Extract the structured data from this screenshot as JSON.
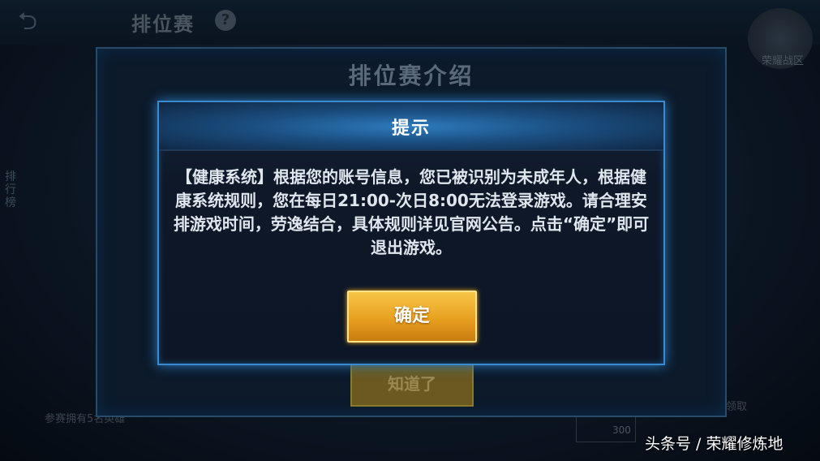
{
  "background": {
    "title": "排位赛",
    "help_icon": "?",
    "back_icon": "back-arrow-icon",
    "honor_label": "荣耀战区",
    "left_label": "排行榜",
    "bottom_text": "参赛拥有5名英雄",
    "right_text": "领取",
    "coin_value": "300"
  },
  "outer_dialog": {
    "title": "排位赛介绍",
    "button_label": "知道了"
  },
  "dialog": {
    "title": "提示",
    "message": "【健康系统】根据您的账号信息，您已被识别为未成年人，根据健康系统规则，您在每日21:00-次日8:00无法登录游戏。请合理安排游戏时间，劳逸结合，具体规则详见官网公告。点击“确定”即可退出游戏。",
    "ok_label": "确定"
  },
  "watermark": "头条号 / 荣耀修炼地",
  "colors": {
    "accent_blue": "#3a8ad0",
    "button_gold": "#e8a020"
  }
}
